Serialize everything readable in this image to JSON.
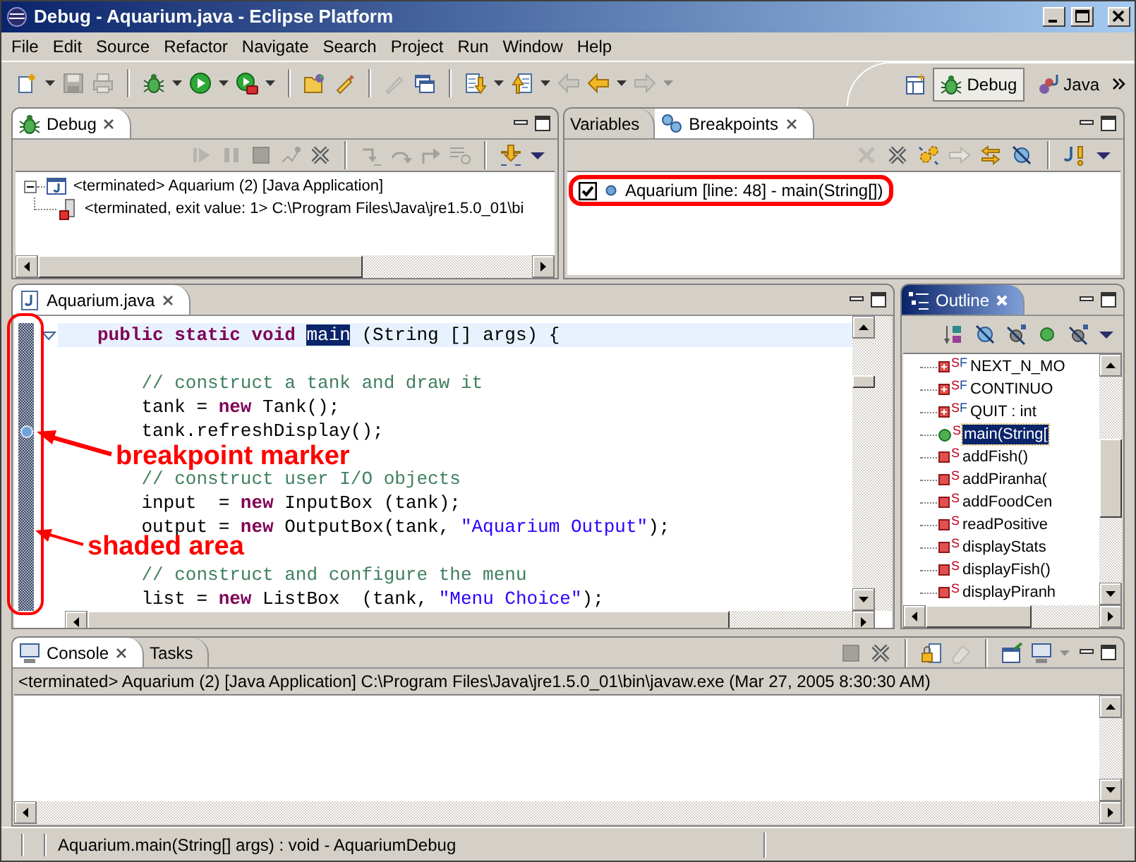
{
  "window": {
    "title": "Debug - Aquarium.java - Eclipse Platform"
  },
  "menu": [
    "File",
    "Edit",
    "Source",
    "Refactor",
    "Navigate",
    "Search",
    "Project",
    "Run",
    "Window",
    "Help"
  ],
  "toolbar": [
    {
      "disabled": false
    },
    {
      "disabled": false
    },
    {
      "disabled": true
    },
    {
      "disabled": true
    },
    {
      "disabled": false
    },
    {
      "disabled": false
    },
    {
      "disabled": false
    },
    {
      "disabled": false
    },
    {
      "disabled": false
    },
    {
      "disabled": false
    },
    {
      "disabled": false
    },
    {
      "disabled": false
    },
    {
      "disabled": true
    },
    {
      "disabled": false
    },
    {
      "disabled": false
    },
    {
      "disabled": false
    },
    {
      "disabled": false
    },
    {
      "disabled": false
    },
    {
      "disabled": true
    },
    {
      "disabled": false
    },
    {
      "disabled": false
    },
    {
      "disabled": true
    },
    {
      "disabled": true
    }
  ],
  "perspectives": [
    {
      "label": "Debug",
      "selected": true
    },
    {
      "label": "Java",
      "selected": false
    }
  ],
  "debug_view": {
    "active": false,
    "tabs": [
      {
        "label": "Debug",
        "selected": true
      }
    ],
    "toolbar": [
      {
        "disabled": true
      },
      {
        "disabled": true
      },
      {
        "disabled": true
      },
      {
        "disabled": true
      },
      {
        "disabled": false
      },
      {
        "disabled": true
      },
      {
        "disabled": true
      },
      {
        "disabled": true
      },
      {
        "disabled": true
      },
      {
        "disabled": false
      },
      {
        "disabled": false
      }
    ],
    "tree": [
      {
        "label": "<terminated> Aquarium (2) [Java Application]",
        "expanded": true,
        "children": [
          {
            "label": "<terminated, exit value: 1> C:\\Program Files\\Java\\jre1.5.0_01\\bi"
          }
        ]
      }
    ]
  },
  "breakpoints_view": {
    "active": false,
    "tabs": [
      {
        "label": "Variables",
        "selected": false
      },
      {
        "label": "Breakpoints",
        "selected": true
      }
    ],
    "toolbar": [
      {
        "disabled": true
      },
      {
        "disabled": false
      },
      {
        "disabled": false
      },
      {
        "disabled": true
      },
      {
        "disabled": false
      },
      {
        "disabled": false
      },
      {
        "disabled": false
      },
      {
        "disabled": false
      }
    ],
    "items": [
      {
        "label": "Aquarium [line: 48] - main(String[])",
        "checked": true
      }
    ]
  },
  "editor": {
    "active": false,
    "tabs": [
      {
        "label": "Aquarium.java",
        "selected": true
      }
    ],
    "lines": [
      {
        "kind": "code",
        "current": true,
        "breakpoint": false,
        "foldable": true,
        "segments": [
          {
            "kind": "keyword",
            "text": "public static void "
          },
          {
            "kind": "selection",
            "text": "main"
          },
          {
            "kind": "plain",
            "text": " (String [] args) {"
          }
        ]
      },
      {
        "kind": "blank"
      },
      {
        "kind": "code",
        "current": false,
        "breakpoint": false,
        "foldable": false,
        "segments": [
          {
            "kind": "comment",
            "text": "    // construct a tank and draw it"
          }
        ]
      },
      {
        "kind": "code",
        "current": false,
        "breakpoint": false,
        "foldable": false,
        "segments": [
          {
            "kind": "plain",
            "text": "    tank = "
          },
          {
            "kind": "keyword",
            "text": "new"
          },
          {
            "kind": "plain",
            "text": " Tank();"
          }
        ]
      },
      {
        "kind": "code",
        "current": false,
        "breakpoint": true,
        "foldable": false,
        "segments": [
          {
            "kind": "plain",
            "text": "    tank.refreshDisplay();"
          }
        ]
      },
      {
        "kind": "blank"
      },
      {
        "kind": "code",
        "current": false,
        "breakpoint": false,
        "foldable": false,
        "segments": [
          {
            "kind": "comment",
            "text": "    // construct user I/O objects"
          }
        ]
      },
      {
        "kind": "code",
        "current": false,
        "breakpoint": false,
        "foldable": false,
        "segments": [
          {
            "kind": "plain",
            "text": "    input  = "
          },
          {
            "kind": "keyword",
            "text": "new"
          },
          {
            "kind": "plain",
            "text": " InputBox (tank);"
          }
        ]
      },
      {
        "kind": "code",
        "current": false,
        "breakpoint": false,
        "foldable": false,
        "segments": [
          {
            "kind": "plain",
            "text": "    output = "
          },
          {
            "kind": "keyword",
            "text": "new"
          },
          {
            "kind": "plain",
            "text": " OutputBox(tank, "
          },
          {
            "kind": "string",
            "text": "\"Aquarium Output\""
          },
          {
            "kind": "plain",
            "text": ");"
          }
        ]
      },
      {
        "kind": "blank"
      },
      {
        "kind": "code",
        "current": false,
        "breakpoint": false,
        "foldable": false,
        "segments": [
          {
            "kind": "comment",
            "text": "    // construct and configure the menu"
          }
        ]
      },
      {
        "kind": "code",
        "current": false,
        "breakpoint": false,
        "foldable": false,
        "segments": [
          {
            "kind": "plain",
            "text": "    list = "
          },
          {
            "kind": "keyword",
            "text": "new"
          },
          {
            "kind": "plain",
            "text": " ListBox  (tank, "
          },
          {
            "kind": "string",
            "text": "\"Menu Choice\""
          },
          {
            "kind": "plain",
            "text": ");"
          }
        ]
      }
    ]
  },
  "outline": {
    "active": true,
    "tabs": [
      {
        "label": "Outline",
        "selected": true
      }
    ],
    "toolbar": [
      {
        "disabled": false
      },
      {
        "disabled": false
      },
      {
        "disabled": false
      },
      {
        "disabled": false
      },
      {
        "disabled": false
      },
      {
        "disabled": false
      }
    ],
    "items": [
      {
        "kind": "field",
        "modifiers": [
          "S",
          "F"
        ],
        "label": "NEXT_N_MO",
        "selected": false
      },
      {
        "kind": "field",
        "modifiers": [
          "S",
          "F"
        ],
        "label": "CONTINUO",
        "selected": false
      },
      {
        "kind": "field",
        "modifiers": [
          "S",
          "F"
        ],
        "label": "QUIT : int",
        "selected": false
      },
      {
        "kind": "public_method",
        "modifiers": [
          "S"
        ],
        "label": "main(String[",
        "selected": true
      },
      {
        "kind": "private_method",
        "modifiers": [
          "S"
        ],
        "label": "addFish()",
        "selected": false
      },
      {
        "kind": "private_method",
        "modifiers": [
          "S"
        ],
        "label": "addPiranha(",
        "selected": false
      },
      {
        "kind": "private_method",
        "modifiers": [
          "S"
        ],
        "label": "addFoodCen",
        "selected": false
      },
      {
        "kind": "private_method",
        "modifiers": [
          "S"
        ],
        "label": "readPositive",
        "selected": false
      },
      {
        "kind": "private_method",
        "modifiers": [
          "S"
        ],
        "label": "displayStats",
        "selected": false
      },
      {
        "kind": "private_method",
        "modifiers": [
          "S"
        ],
        "label": "displayFish()",
        "selected": false
      },
      {
        "kind": "private_method",
        "modifiers": [
          "S"
        ],
        "label": "displayPiranh",
        "selected": false
      }
    ]
  },
  "console": {
    "active": false,
    "tabs": [
      {
        "label": "Console",
        "selected": true
      },
      {
        "label": "Tasks",
        "selected": false
      }
    ],
    "toolbar": [
      {
        "disabled": true
      },
      {
        "disabled": false
      },
      {
        "disabled": false
      },
      {
        "disabled": true
      },
      {
        "disabled": false
      },
      {
        "disabled": false
      },
      {
        "disabled": true
      }
    ],
    "header": "<terminated> Aquarium (2) [Java Application] C:\\Program Files\\Java\\jre1.5.0_01\\bin\\javaw.exe (Mar 27, 2005 8:30:30 AM)"
  },
  "annotations": [
    {
      "text": "breakpoint marker"
    },
    {
      "text": "shaded area"
    }
  ],
  "status_bar": {
    "text": "Aquarium.main(String[] args) : void - AquariumDebug"
  }
}
